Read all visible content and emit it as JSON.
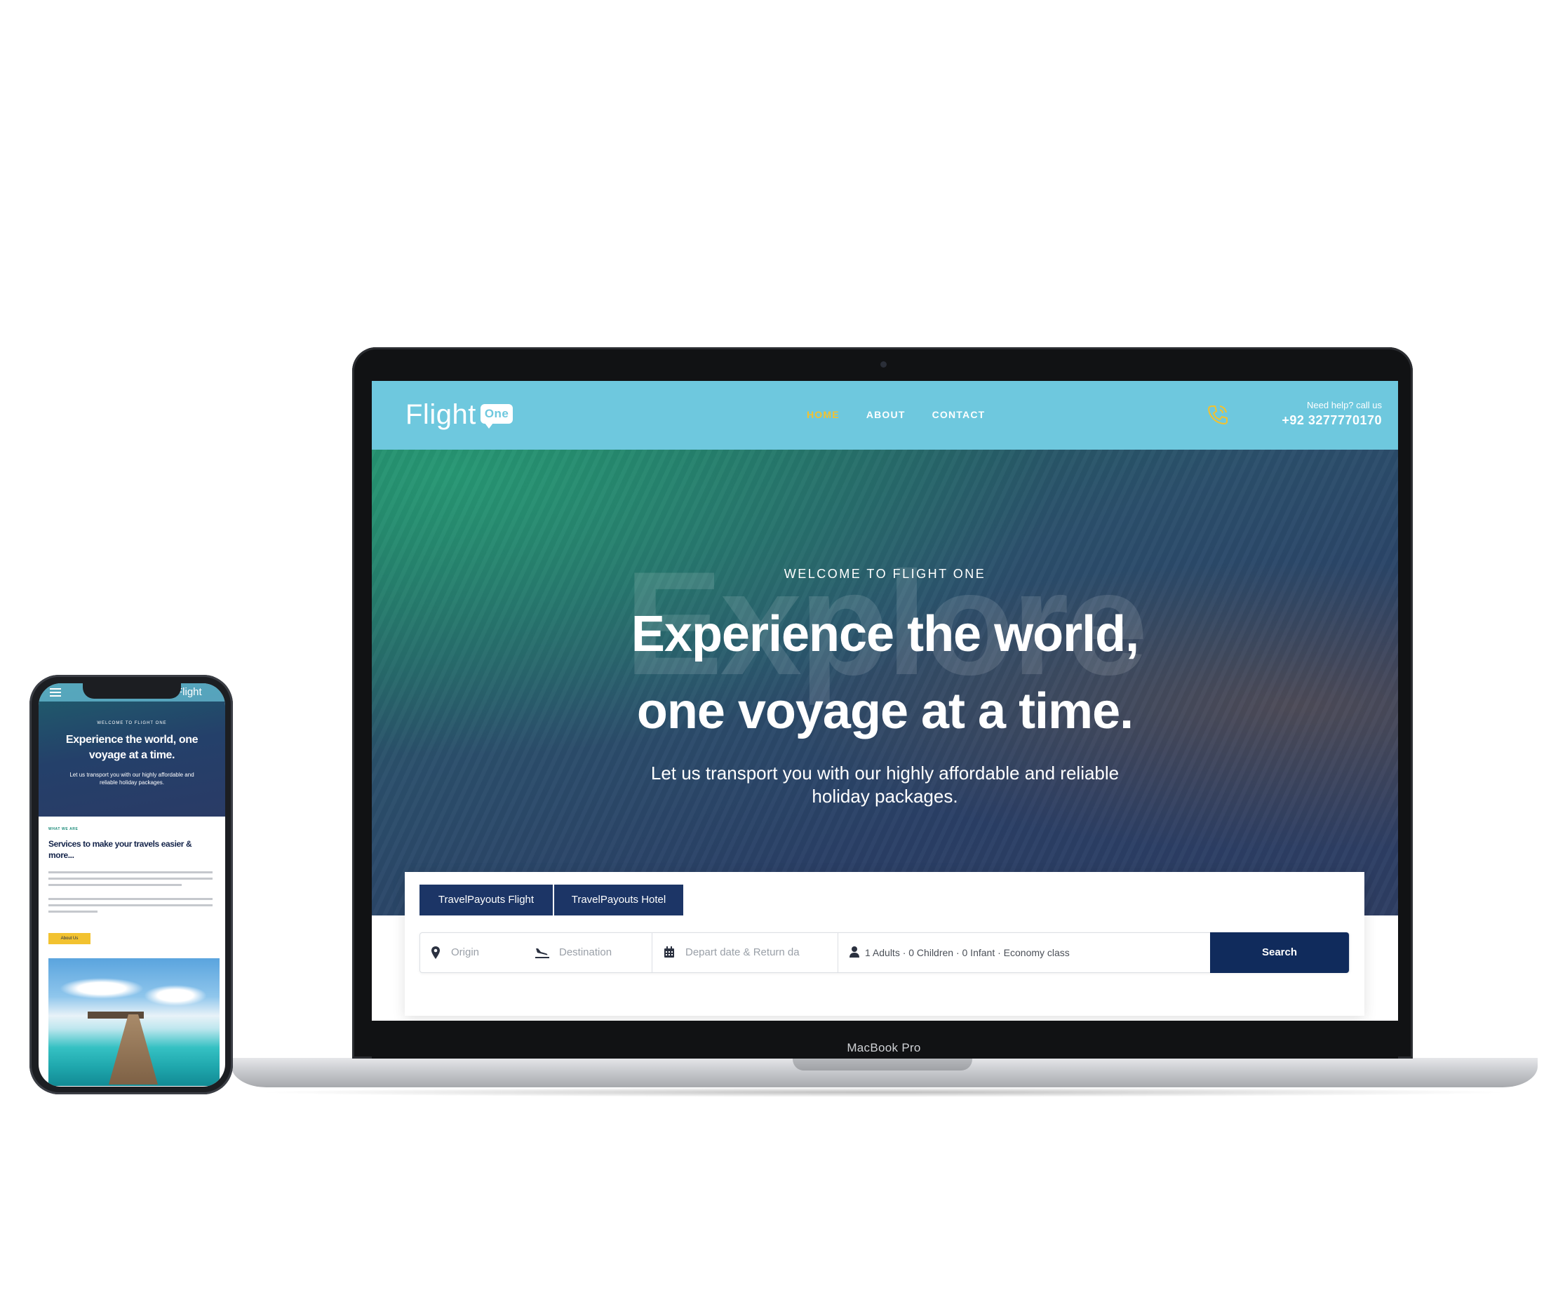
{
  "site": {
    "logo_word": "Flight",
    "logo_badge": "One",
    "nav": [
      "HOME",
      "ABOUT",
      "CONTACT"
    ],
    "help_label": "Need help? call us",
    "help_phone": "+92 3277770170",
    "colors": {
      "nav_bg": "#6ec8de",
      "accent": "#f2c230",
      "primary": "#102b5c"
    }
  },
  "hero": {
    "kicker": "WELCOME TO FLIGHT ONE",
    "watermark": "Explore",
    "title_line1": "Experience the world,",
    "title_line2": "one voyage at a time.",
    "subtitle_line1": "Let us transport you with our highly affordable and reliable",
    "subtitle_line2": "holiday packages."
  },
  "search": {
    "tabs": [
      "TravelPayouts Flight",
      "TravelPayouts Hotel"
    ],
    "origin_placeholder": "Origin",
    "destination_placeholder": "Destination",
    "dates_placeholder": "Depart date & Return da",
    "passengers": "1 Adults · 0 Children · 0 Infant · Economy class",
    "button": "Search"
  },
  "device": {
    "laptop_label": "MacBook Pro"
  },
  "mobile": {
    "logo": "Flight",
    "kicker": "WELCOME TO FLIGHT ONE",
    "title_line1": "Experience the world, one",
    "title_line2": "voyage at a time.",
    "subtitle_line1": "Let us transport you with our highly affordable and",
    "subtitle_line2": "reliable holiday packages.",
    "eyebrow": "WHAT WE ARE",
    "heading_line1": "Services to make your travels easier &",
    "heading_line2": "more...",
    "button": "About Us"
  }
}
